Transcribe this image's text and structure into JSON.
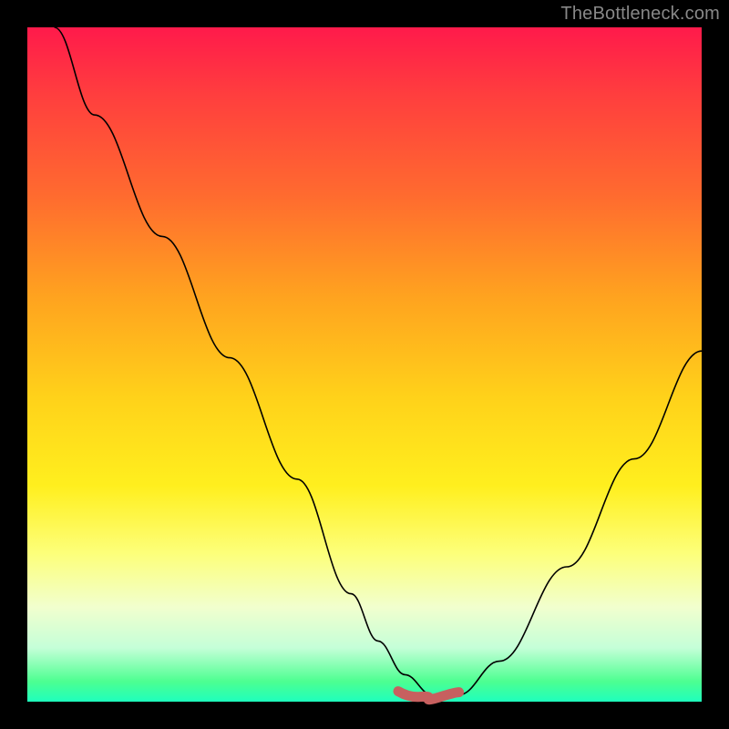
{
  "watermark": "TheBottleneck.com",
  "chart_data": {
    "type": "line",
    "title": "",
    "xlabel": "",
    "ylabel": "",
    "xlim": [
      0,
      100
    ],
    "ylim": [
      0,
      100
    ],
    "series": [
      {
        "name": "bottleneck-curve",
        "x": [
          4,
          10,
          20,
          30,
          40,
          48,
          52,
          56,
          60,
          62,
          64,
          70,
          80,
          90,
          100
        ],
        "y": [
          100,
          87,
          69,
          51,
          33,
          16,
          9,
          4,
          1,
          0.5,
          1,
          6,
          20,
          36,
          52
        ]
      }
    ],
    "highlight": {
      "name": "optimal-zone",
      "x_range": [
        55,
        64
      ],
      "y": 1,
      "color": "#c7605f"
    },
    "gradient_stops": [
      {
        "pos": 0,
        "color": "#ff1a4b"
      },
      {
        "pos": 50,
        "color": "#ffd21a"
      },
      {
        "pos": 100,
        "color": "#1effbd"
      }
    ]
  }
}
